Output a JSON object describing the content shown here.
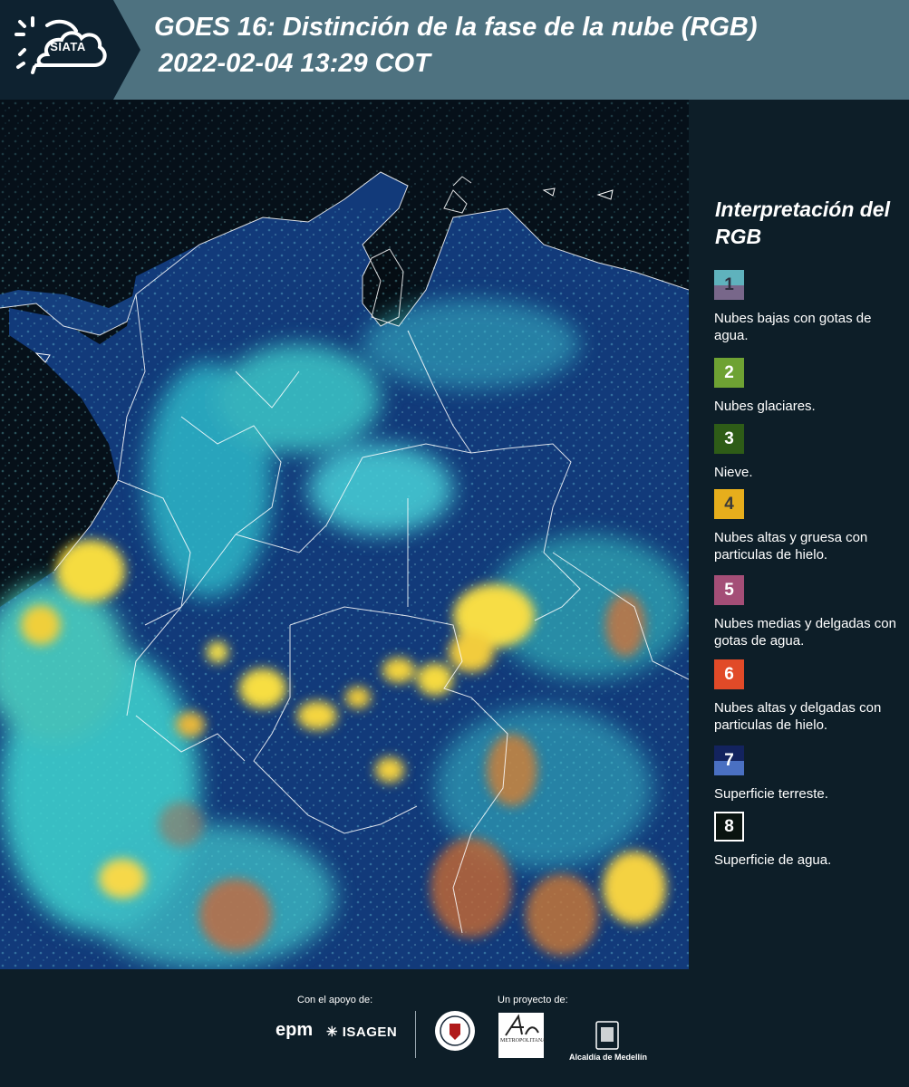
{
  "header": {
    "logo_text": "SIATA",
    "title_line1": "GOES 16: Distinción de la fase de la nube (RGB)",
    "title_line2": "2022-02-04 13:29 COT"
  },
  "map": {
    "type": "satellite-rgb-composite",
    "palette": {
      "water": "#061019",
      "land": "#10336e",
      "low_cloud": "#7fe2e4",
      "glaciated": "#3bd8c8",
      "thick_ice": "#f3d53a",
      "orange_ice": "#d87a2a"
    }
  },
  "legend": {
    "title": "Interpretación del RGB",
    "items": [
      {
        "number": "1",
        "label": "Nubes bajas con gotas de agua.",
        "color_top": "#5fb2bd",
        "color_bottom": "#78678a",
        "text_color": "#2e2e3e"
      },
      {
        "number": "2",
        "label": "Nubes glaciares.",
        "color": "#6ea233",
        "text_color": "#ffffff"
      },
      {
        "number": "3",
        "label": "Nieve.",
        "color": "#2e5c17",
        "text_color": "#ffffff"
      },
      {
        "number": "4",
        "label": "Nubes altas y gruesa con particulas de hielo.",
        "color": "#e6ae1c",
        "text_color": "#3a3a3a"
      },
      {
        "number": "5",
        "label": "Nubes medias y delgadas con gotas de agua.",
        "color": "#a44e77",
        "text_color": "#ffffff"
      },
      {
        "number": "6",
        "label": "Nubes altas y delgadas con particulas de hielo.",
        "color": "#e14a28",
        "text_color": "#ffffff"
      },
      {
        "number": "7",
        "label": "Superficie terreste.",
        "color_top": "#13235e",
        "color_bottom": "#4a70c2",
        "text_color": "#ffffff"
      },
      {
        "number": "8",
        "label": "Superficie de agua.",
        "color": "#0a1410",
        "border": "#ffffff",
        "text_color": "#ffffff"
      }
    ]
  },
  "footer": {
    "support_caption": "Con el apoyo de:",
    "project_caption": "Un proyecto de:",
    "epm_logo": "epm",
    "isagen_logo": "ISAGEN",
    "area_logo": "METROPOLITANA",
    "medellin_logo": "Alcaldía de Medellín"
  }
}
